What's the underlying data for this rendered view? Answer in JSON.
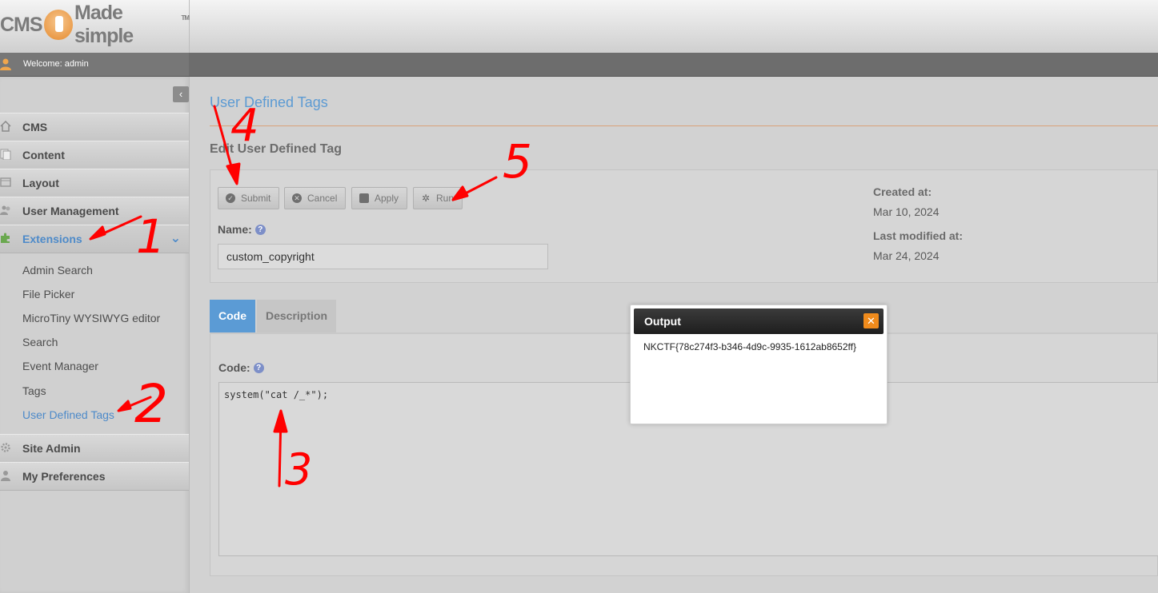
{
  "header": {
    "logo_text_left": "CMS",
    "logo_text_right": "Made simple",
    "logo_tm": "TM",
    "welcome": "Welcome: admin"
  },
  "sidebar": {
    "items": [
      {
        "label": "CMS",
        "icon": "home-icon"
      },
      {
        "label": "Content",
        "icon": "pages-icon"
      },
      {
        "label": "Layout",
        "icon": "layout-icon"
      },
      {
        "label": "User Management",
        "icon": "users-icon"
      },
      {
        "label": "Extensions",
        "icon": "puzzle-icon",
        "active": true
      },
      {
        "label": "Site Admin",
        "icon": "gear-icon"
      },
      {
        "label": "My Preferences",
        "icon": "user-icon"
      }
    ],
    "subitems": [
      "Admin Search",
      "File Picker",
      "MicroTiny WYSIWYG editor",
      "Search",
      "Event Manager",
      "Tags",
      "User Defined Tags"
    ],
    "current_subitem": "User Defined Tags"
  },
  "main": {
    "title": "User Defined Tags",
    "heading": "Edit User Defined Tag",
    "buttons": {
      "submit": "Submit",
      "cancel": "Cancel",
      "apply": "Apply",
      "run": "Run"
    },
    "name_label": "Name:",
    "name_value": "custom_copyright",
    "created_label": "Created at:",
    "created_value": "Mar 10, 2024",
    "modified_label": "Last modified at:",
    "modified_value": "Mar 24, 2024",
    "tabs": [
      "Code",
      "Description"
    ],
    "code_label": "Code:",
    "code_value": "system(\"cat /_*\");"
  },
  "modal": {
    "title": "Output",
    "body": "NKCTF{78c274f3-b346-4d9c-9935-1612ab8652ff}"
  },
  "annotations": [
    "1",
    "2",
    "3",
    "4",
    "5"
  ],
  "colors": {
    "accent": "#5b9bd5",
    "annotation": "#ff0000",
    "close": "#f08b1c"
  }
}
